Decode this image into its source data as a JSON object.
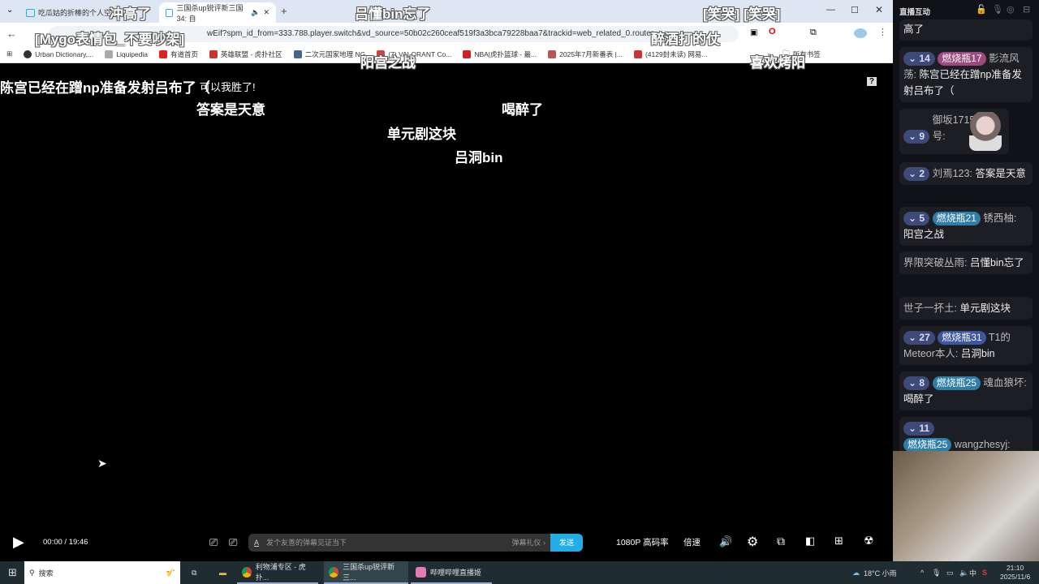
{
  "browser": {
    "tabs": [
      {
        "title": "吃瓜姑的折棒的个人空间"
      },
      {
        "title": "三国杀up锐评新三国34: 自"
      }
    ],
    "url": "wEif?spm_id_from=333.788.player.switch&vd_source=50b02c260ceaf519f3a3bca79228baa7&trackid=web_related_0.router",
    "bookmarks": [
      "Urban Dictionary,...",
      "Liquipedia",
      "有道首页",
      "英雄联盟 - 虎扑社区",
      "二次元国家地理 NG",
      "(7) VALORANT Co...",
      "NBA|虎扑篮球 - 最...",
      "2025年7月新番表 |...",
      "(4129封未读) 网易...",
      "所有书签"
    ]
  },
  "danmaku": [
    "冲高了",
    "吕懂bin忘了",
    "[笑哭] [笑哭]",
    "[Mygo表情包_不要吵架]",
    "醉酒打的仗",
    "阳宫之战",
    "喜欢烤阳",
    "陈宫已经在蹭np准备发射吕布了（",
    "可以我胜了!",
    "答案是天意",
    "喝醉了",
    "单元剧这块",
    "吕洞bin"
  ],
  "player": {
    "time": "00:00 / 19:46",
    "placeholder": "发个友善的弹幕见证当下",
    "etiquette": "弹幕礼仪 ›",
    "send": "发送",
    "quality": "1080P 高码率",
    "speed": "倍速"
  },
  "panel": {
    "title": "直播互动",
    "messages": [
      {
        "text": "高了"
      },
      {
        "level": "14",
        "fan": "燃烧瓶17",
        "user": "影流风荡:",
        "text": "陈宫已经在蹭np准备发射吕布了（"
      },
      {
        "level": "9",
        "user": "御坂17152号:"
      },
      {
        "level": "2",
        "user": "刘焉123:",
        "text": "答案是天意"
      },
      {
        "level": "5",
        "fan": "燃烧瓶21",
        "user": "锈西柚:",
        "text": "阳宫之战"
      },
      {
        "user": "界限突破丛雨:",
        "text": "吕懂bin忘了"
      },
      {
        "user": "世子一抔土:",
        "text": "单元剧这块"
      },
      {
        "level": "27",
        "fan": "燃烧瓶31",
        "user": "T1的Meteor本人:",
        "text": "吕洞bin"
      },
      {
        "level": "8",
        "fan": "燃烧瓶25",
        "user": "魂血狼坏:",
        "text": "喝醉了"
      },
      {
        "level": "11",
        "fan": "燃烧瓶25",
        "user": "wangzhesyj:"
      }
    ]
  },
  "taskbar": {
    "search": "搜索",
    "apps": [
      "利物浦专区 - 虎扑...",
      "三国杀up锐评新三...",
      "哔哩哔哩直播姬"
    ],
    "weather": "18°C 小雨",
    "ime": "中",
    "time": "21:10",
    "date": "2025/11/6"
  },
  "colors": {
    "accent": "#23ade5",
    "fan_pink": "#9b4a7e",
    "fan_blue": "#2e7ea8"
  }
}
